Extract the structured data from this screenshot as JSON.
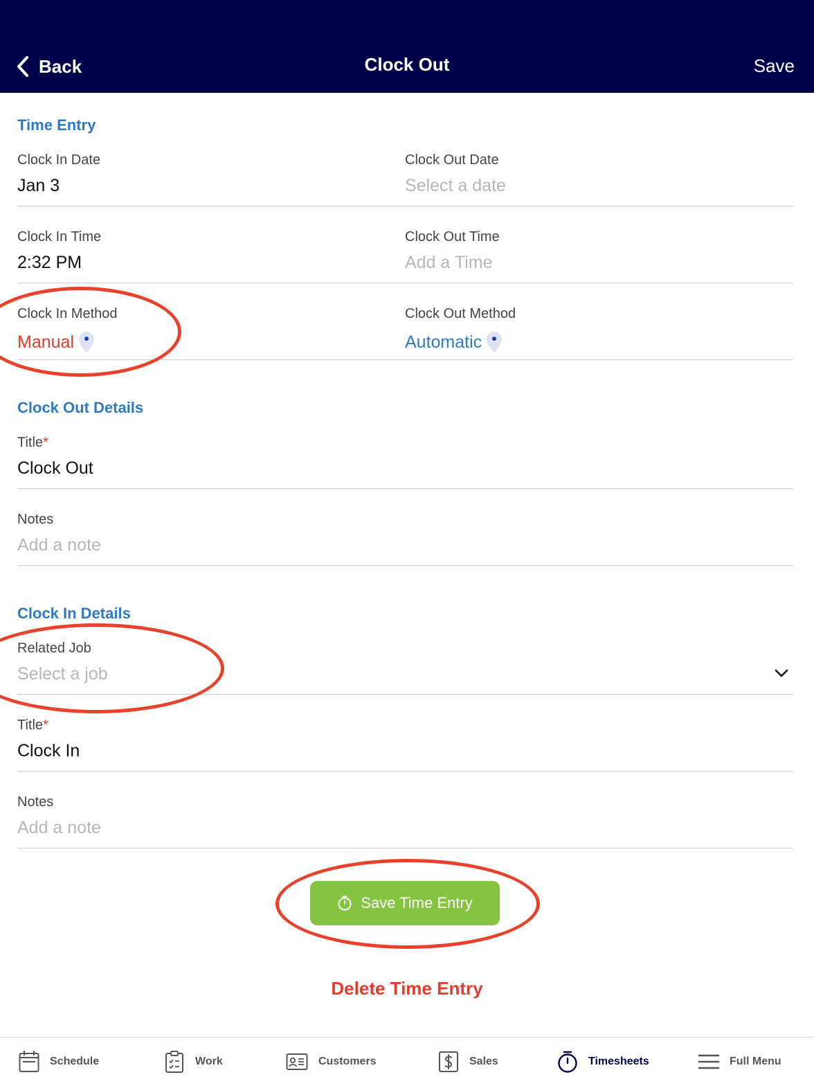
{
  "header": {
    "back_label": "Back",
    "title": "Clock Out",
    "save_label": "Save",
    "background": "#01034a"
  },
  "time_entry": {
    "section_title": "Time Entry",
    "clock_in_date": {
      "label": "Clock In Date",
      "value": "Jan 3"
    },
    "clock_out_date": {
      "label": "Clock Out Date",
      "placeholder": "Select a date"
    },
    "clock_in_time": {
      "label": "Clock In Time",
      "value": "2:32 PM"
    },
    "clock_out_time": {
      "label": "Clock Out Time",
      "placeholder": "Add a Time"
    },
    "clock_in_method": {
      "label": "Clock In Method",
      "value": "Manual",
      "color": "#e53b2d",
      "icon": "location-pin-icon"
    },
    "clock_out_method": {
      "label": "Clock Out Method",
      "value": "Automatic",
      "color": "#2f7ac0",
      "icon": "location-pin-icon"
    }
  },
  "clock_out_details": {
    "section_title": "Clock Out Details",
    "title_field": {
      "label": "Title",
      "required_mark": "*",
      "value": "Clock Out"
    },
    "notes_field": {
      "label": "Notes",
      "placeholder": "Add a note"
    }
  },
  "clock_in_details": {
    "section_title": "Clock In Details",
    "related_job": {
      "label": "Related Job",
      "placeholder": "Select a job",
      "icon": "chevron-down-icon"
    },
    "title_field": {
      "label": "Title",
      "required_mark": "*",
      "value": "Clock In"
    },
    "notes_field": {
      "label": "Notes",
      "placeholder": "Add a note"
    }
  },
  "actions": {
    "save_entry_label": "Save Time Entry",
    "save_entry_icon": "stopwatch-icon",
    "save_entry_color": "#85c441",
    "delete_entry_label": "Delete Time Entry",
    "delete_entry_color": "#e53b2d"
  },
  "tabbar": {
    "items": [
      {
        "label": "Schedule",
        "icon": "calendar-icon"
      },
      {
        "label": "Work",
        "icon": "clipboard-icon"
      },
      {
        "label": "Customers",
        "icon": "contact-card-icon"
      },
      {
        "label": "Sales",
        "icon": "dollar-icon"
      },
      {
        "label": "Timesheets",
        "icon": "stopwatch-icon",
        "active": true
      },
      {
        "label": "Full Menu",
        "icon": "hamburger-icon"
      }
    ]
  },
  "colors": {
    "section_title": "#2f7ac0",
    "annotation_circle": "#e8412c"
  }
}
